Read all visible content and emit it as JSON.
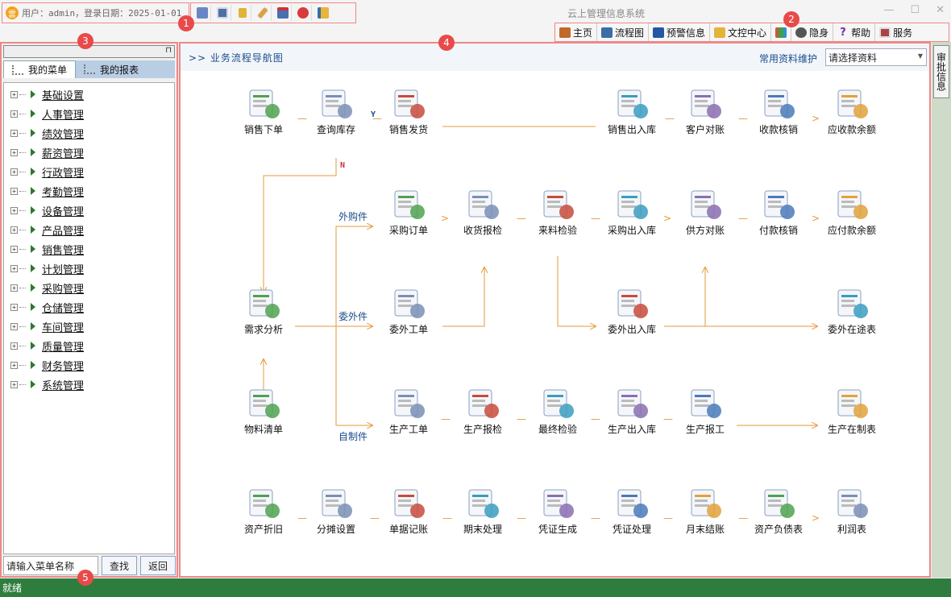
{
  "header": {
    "user_info": "用户：admin，登录日期：2025-01-01",
    "user_icon_text": "雲",
    "app_title": "云上管理信息系统",
    "toolbar_icons": [
      "user-switch-icon",
      "form-icon",
      "key-icon",
      "broom-icon",
      "calendar-icon",
      "close-circle-icon",
      "exit-icon"
    ],
    "window_controls": [
      "minimize-icon",
      "maximize-icon",
      "close-icon"
    ],
    "nav": [
      {
        "label": "主页",
        "icon": "home-icon",
        "color": "#c0692b"
      },
      {
        "label": "流程图",
        "icon": "flowchart-icon",
        "color": "#3a6ea5"
      },
      {
        "label": "预警信息",
        "icon": "alert-icon",
        "color": "#2456a4"
      },
      {
        "label": "文控中心",
        "icon": "folder-icon",
        "color": "#e2b43a"
      },
      {
        "label": "",
        "icon": "brand-icon",
        "color": "#e44"
      },
      {
        "label": "隐身",
        "icon": "users-icon",
        "color": "#555"
      },
      {
        "label": "帮助",
        "icon": "help-icon",
        "color": "#7a2aa8"
      },
      {
        "label": "服务",
        "icon": "service-icon",
        "color": "#a44"
      }
    ]
  },
  "badges": [
    "1",
    "2",
    "3",
    "4",
    "5"
  ],
  "sidebar": {
    "tabs": [
      {
        "label": "我的菜单"
      },
      {
        "label": "我的报表"
      }
    ],
    "items": [
      {
        "label": "基础设置"
      },
      {
        "label": "人事管理"
      },
      {
        "label": "绩效管理"
      },
      {
        "label": "薪资管理"
      },
      {
        "label": "行政管理"
      },
      {
        "label": "考勤管理"
      },
      {
        "label": "设备管理"
      },
      {
        "label": "产品管理"
      },
      {
        "label": "销售管理"
      },
      {
        "label": "计划管理"
      },
      {
        "label": "采购管理"
      },
      {
        "label": "仓储管理"
      },
      {
        "label": "车间管理"
      },
      {
        "label": "质量管理"
      },
      {
        "label": "财务管理"
      },
      {
        "label": "系统管理"
      }
    ],
    "search_placeholder": "请输入菜单名称",
    "search_value": "请输入菜单名称",
    "find_label": "查找",
    "back_label": "返回"
  },
  "main": {
    "title": ">>  业务流程导航图",
    "doc_maint_label": "常用资料维护",
    "select_value": "请选择资料",
    "flow_nodes": {
      "r1": [
        "销售下单",
        "查询库存",
        "销售发货",
        "销售出入库",
        "客户对账",
        "收款核销",
        "应收款余额"
      ],
      "r2": [
        "采购订单",
        "收货报检",
        "来料检验",
        "采购出入库",
        "供方对账",
        "付款核销",
        "应付款余额"
      ],
      "r3": [
        "需求分析",
        "委外工单",
        "委外出入库",
        "委外在途表"
      ],
      "r4": [
        "物料清单",
        "生产工单",
        "生产报检",
        "最终检验",
        "生产出入库",
        "生产报工",
        "生产在制表"
      ],
      "r5": [
        "资产折旧",
        "分摊设置",
        "单据记账",
        "期末处理",
        "凭证生成",
        "凭证处理",
        "月末结账",
        "资产负债表",
        "利润表"
      ]
    },
    "branch_labels": {
      "outsource_buy": "外购件",
      "outsource": "委外件",
      "self_made": "自制件",
      "yes": "Y",
      "no": "N"
    },
    "separators": {
      "dash": "—",
      "arrow": ">",
      "up": "^"
    }
  },
  "right_tab": "审批信息",
  "status": "就绪"
}
